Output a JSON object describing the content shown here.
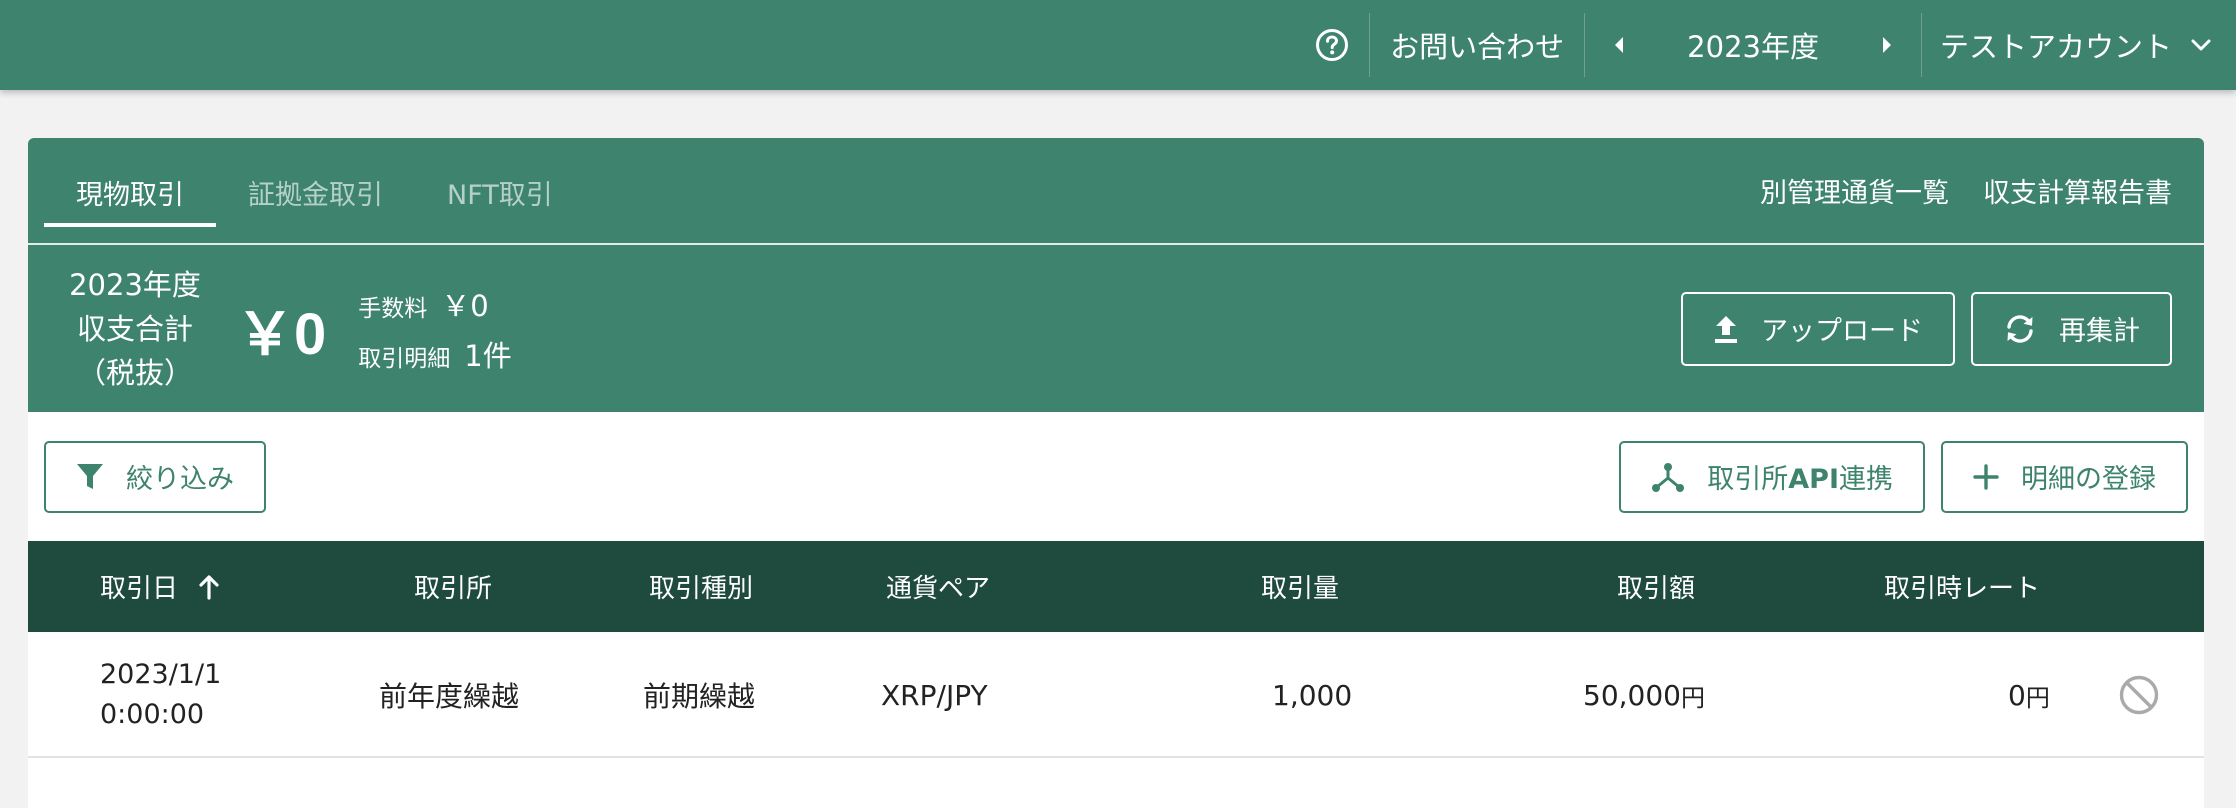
{
  "topbar": {
    "help_icon": "question-circle-icon",
    "contact_label": "お問い合わせ",
    "year_label": "2023年度",
    "account_label": "テストアカウント"
  },
  "tabs": [
    {
      "label": "現物取引",
      "active": true
    },
    {
      "label": "証拠金取引",
      "active": false
    },
    {
      "label": "NFT取引",
      "active": false
    }
  ],
  "head_links": {
    "currency_list": "別管理通貨一覧",
    "report": "収支計算報告書"
  },
  "summary": {
    "label_line1": "2023年度",
    "label_line2": "収支合計",
    "label_line3": "（税抜）",
    "total": "￥0",
    "fee_label": "手数料",
    "fee_value": "￥0",
    "count_label": "取引明細",
    "count_value": "1件",
    "upload_label": "アップロード",
    "recalc_label": "再集計"
  },
  "toolbar": {
    "filter_label": "絞り込み",
    "api_label_prefix": "取引所",
    "api_label_bold": "API",
    "api_label_suffix": "連携",
    "add_label": "明細の登録"
  },
  "table": {
    "columns": {
      "date": "取引日",
      "exchange": "取引所",
      "type": "取引種別",
      "pair": "通貨ペア",
      "volume": "取引量",
      "amount": "取引額",
      "rate": "取引時レート"
    },
    "sort": "ascending",
    "rows": [
      {
        "date_line1": "2023/1/1",
        "date_line2": "0:00:00",
        "exchange": "前年度繰越",
        "type": "前期繰越",
        "pair": "XRP/JPY",
        "volume": "1,000",
        "amount": "50,000",
        "amount_unit": "円",
        "rate": "0",
        "rate_unit": "円"
      }
    ]
  },
  "colors": {
    "primary": "#3d836d",
    "header_dark": "#1f4a3e",
    "background": "#f2f2f2"
  }
}
